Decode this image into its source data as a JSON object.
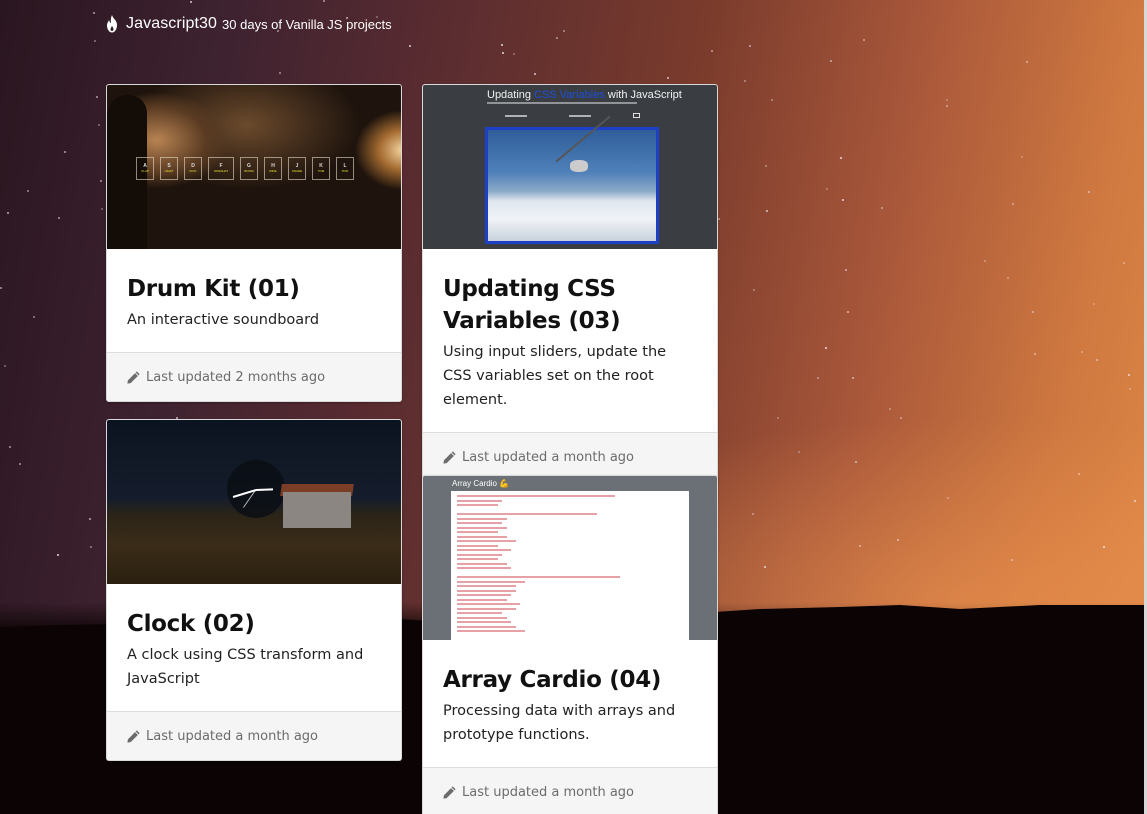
{
  "navbar": {
    "logo_icon": "flame-icon",
    "brand": "Javascript30",
    "tagline": "30 days of Vanilla JS projects"
  },
  "cards": [
    {
      "title": "Drum Kit (01)",
      "description": "An interactive soundboard",
      "footer_icon": "pencil-icon",
      "updated": "Last updated 2 months ago",
      "thumbnail": {
        "keys": [
          {
            "key": "A",
            "sound": "CLAP"
          },
          {
            "key": "S",
            "sound": "HIHAT"
          },
          {
            "key": "D",
            "sound": "KICK"
          },
          {
            "key": "F",
            "sound": "OPENHAT"
          },
          {
            "key": "G",
            "sound": "BOOM"
          },
          {
            "key": "H",
            "sound": "RIDE"
          },
          {
            "key": "J",
            "sound": "SNARE"
          },
          {
            "key": "K",
            "sound": "TOM"
          },
          {
            "key": "L",
            "sound": "TINK"
          }
        ]
      }
    },
    {
      "title": "Clock (02)",
      "description": "A clock using CSS transform and JavaScript",
      "footer_icon": "pencil-icon",
      "updated": "Last updated a month ago"
    },
    {
      "title": "Updating CSS Variables (03)",
      "description": "Using input sliders, update the CSS variables set on the root element.",
      "footer_icon": "pencil-icon",
      "updated": "Last updated a month ago",
      "thumbnail": {
        "heading_pre": "Updating ",
        "heading_highlight": "CSS Variables",
        "heading_post": " with JavaScript",
        "highlight_color": "#1e4fd8"
      }
    },
    {
      "title": "Array Cardio (04)",
      "description": "Processing data with arrays and prototype functions.",
      "footer_icon": "pencil-icon",
      "updated": "Last updated a month ago",
      "thumbnail": {
        "heading": "Array Cardio",
        "emoji": "💪"
      }
    }
  ],
  "colors": {
    "card_bg": "#ffffff",
    "footer_bg": "#f5f5f5",
    "footer_text": "#6c6c6c",
    "title_text": "#111111"
  }
}
